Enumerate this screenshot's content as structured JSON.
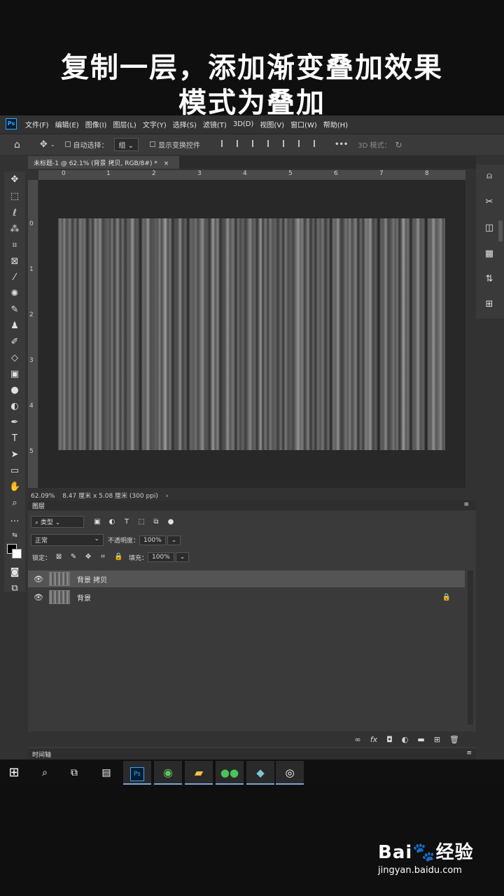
{
  "caption": {
    "line1": "复制一层，添加渐变叠加效果",
    "line2": "模式为叠加"
  },
  "menubar": {
    "logo": "Ps",
    "items": [
      "文件(F)",
      "编辑(E)",
      "图像(I)",
      "图层(L)",
      "文字(Y)",
      "选择(S)",
      "滤镜(T)",
      "3D(D)",
      "视图(V)",
      "窗口(W)",
      "帮助(H)"
    ]
  },
  "options": {
    "auto_select_label": "自动选择：",
    "group_value": "组",
    "show_transform_label": "显示变换控件",
    "more_label": "•••",
    "mode3d_label": "3D 模式："
  },
  "document": {
    "tab_title": "未标题-1 @ 62.1% (背景 拷贝, RGB/8#) *",
    "status_zoom": "62.09%",
    "status_info": "8.47 厘米 x 5.08 厘米 (300 ppi)"
  },
  "ruler": {
    "h_ticks": [
      "0",
      "1",
      "2",
      "3",
      "4",
      "5",
      "6",
      "7",
      "8"
    ],
    "v_ticks": [
      "0",
      "1",
      "2",
      "3",
      "4",
      "5"
    ]
  },
  "layers_panel": {
    "title": "图层",
    "filter_label": "类型",
    "blend_mode": "正常",
    "opacity_label": "不透明度：",
    "opacity_value": "100%",
    "lock_label": "锁定：",
    "fill_label": "填充：",
    "fill_value": "100%",
    "layers": [
      {
        "name": "背景 拷贝",
        "selected": true
      },
      {
        "name": "背景",
        "locked": true
      }
    ],
    "timeline_label": "时间轴"
  },
  "watermark": {
    "brand": "Bai🐾经验",
    "url": "jingyan.baidu.com"
  },
  "colors": {
    "app_bg": "#323232",
    "panel_bg": "#3a3a3a",
    "canvas_bg": "#282828",
    "accent": "#31a8ff"
  }
}
